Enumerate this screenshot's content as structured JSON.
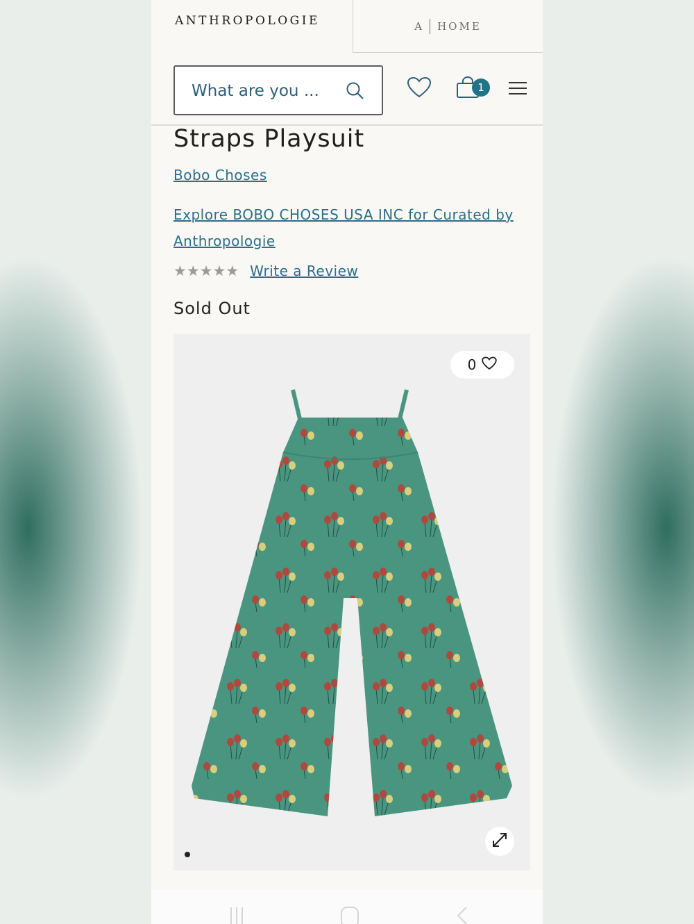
{
  "header": {
    "brand": "ANTHROPOLOGIE",
    "home_tab_a": "A",
    "home_tab_label": "HOME"
  },
  "search": {
    "placeholder": "What are you ..."
  },
  "cart": {
    "count": "1"
  },
  "product": {
    "title": "Straps Playsuit",
    "brand_link": "Bobo Choses",
    "explore_link": "Explore BOBO CHOSES USA INC for Curated by Anthropologie",
    "rating_stars": 5,
    "review_link": "Write a Review",
    "status": "Sold Out",
    "like_count": "0",
    "garment_color": "#4a9580"
  },
  "colors": {
    "link": "#2b6f88",
    "badge": "#1e7587"
  }
}
